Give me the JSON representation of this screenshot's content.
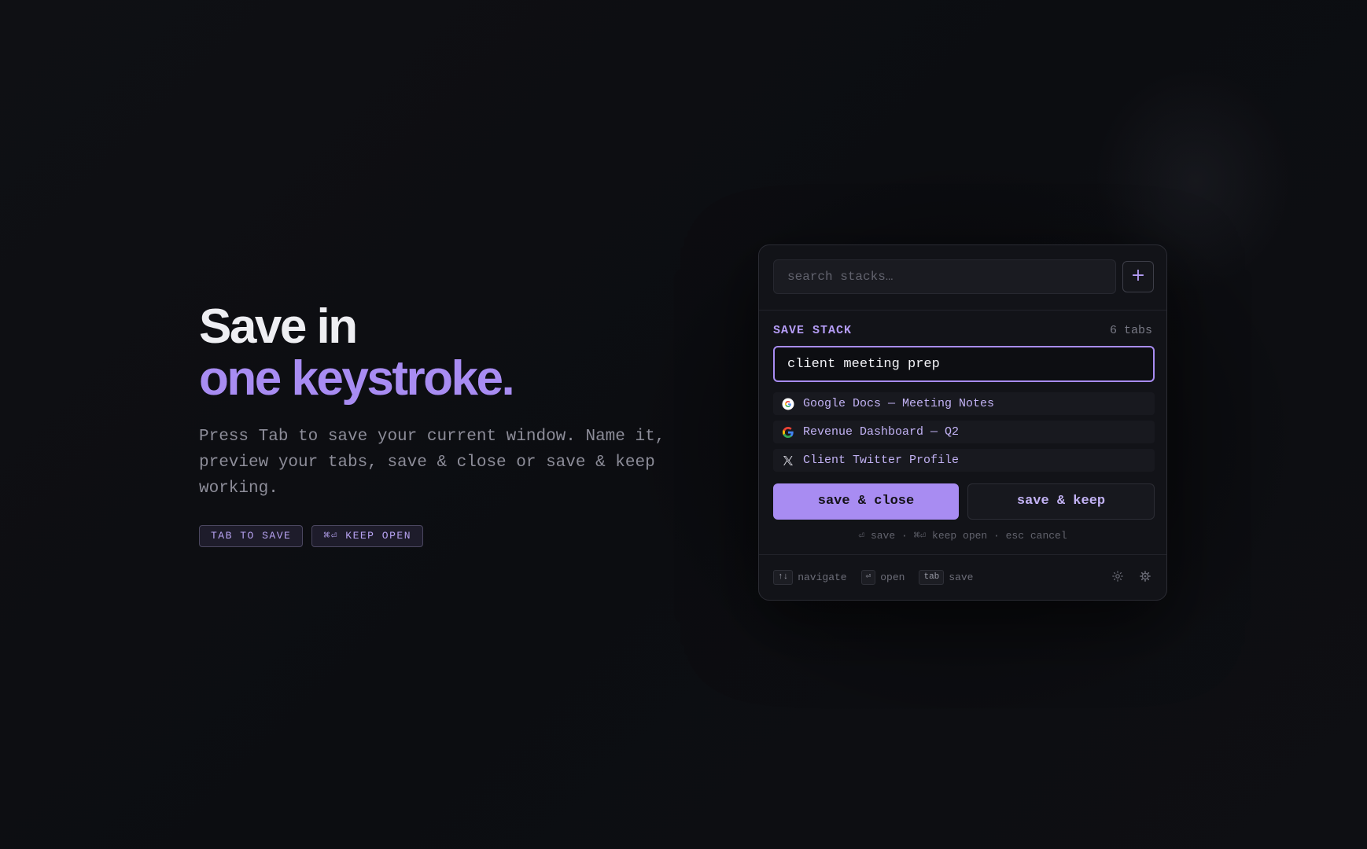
{
  "hero": {
    "title_line1": "Save in",
    "title_line2": "one keystroke.",
    "description": "Press Tab to save your current window. Name it, preview your tabs, save & close or save & keep working.",
    "badges": [
      "TAB TO SAVE",
      "⌘⏎ KEEP OPEN"
    ]
  },
  "panel": {
    "search": {
      "placeholder": "search stacks…",
      "value": ""
    },
    "add_button_label": "+",
    "section_title": "SAVE STACK",
    "tab_count": "6 tabs",
    "stack_name": "client meeting prep",
    "tabs": [
      {
        "label": "Google Docs — Meeting Notes",
        "icon": "google-icon"
      },
      {
        "label": "Revenue Dashboard — Q2",
        "icon": "google-icon"
      },
      {
        "label": "Client Twitter Profile",
        "icon": "x-icon"
      }
    ],
    "save_close_label": "save & close",
    "save_keep_label": "save & keep",
    "hint": "⏎ save · ⌘⏎ keep open · esc cancel",
    "footer": {
      "navigate_key": "↑↓",
      "navigate_label": "navigate",
      "open_key": "⏎",
      "open_label": "open",
      "save_key": "tab",
      "save_label": "save",
      "theme_icon": "sun-icon",
      "settings_icon": "gear-icon"
    }
  },
  "colors": {
    "accent": "#a88cf2",
    "background": "#0d0e12",
    "panel": "#121318"
  }
}
